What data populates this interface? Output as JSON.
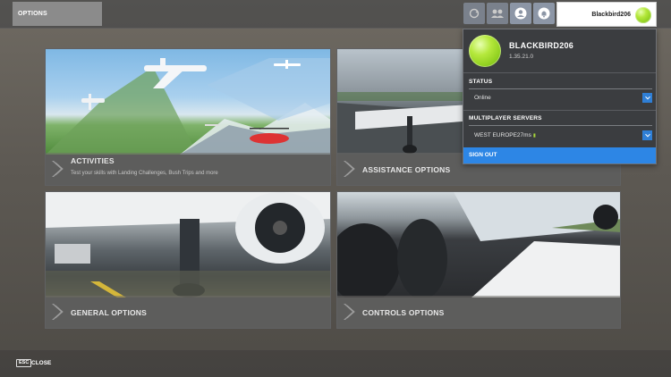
{
  "header": {
    "title": "OPTIONS",
    "icons": [
      "refresh-icon",
      "friends-icon",
      "profile-icon",
      "notifications-icon"
    ],
    "user": {
      "name": "Blackbird206"
    }
  },
  "cards": [
    {
      "id": "activities",
      "label": "ACTIVITIES",
      "description": "Test your skills with Landing Challenges, Bush Trips and more"
    },
    {
      "id": "assistance",
      "label": "ASSISTANCE OPTIONS"
    },
    {
      "id": "general",
      "label": "GENERAL OPTIONS"
    },
    {
      "id": "controls",
      "label": "CONTROLS OPTIONS"
    }
  ],
  "profile_panel": {
    "name": "BLACKBIRD206",
    "version": "1.35.21.0",
    "status_label": "STATUS",
    "status_value": "Online",
    "servers_label": "MULTIPLAYER SERVERS",
    "server_value": "WEST EUROPE",
    "server_ping": "27ms",
    "sign_out": "SIGN OUT"
  },
  "footer": {
    "esc_key": "ESC",
    "close_label": "CLOSE"
  },
  "colors": {
    "accent": "#2d86e5",
    "avatar": "#a6d43a",
    "panel_bg": "#3b3d40"
  }
}
